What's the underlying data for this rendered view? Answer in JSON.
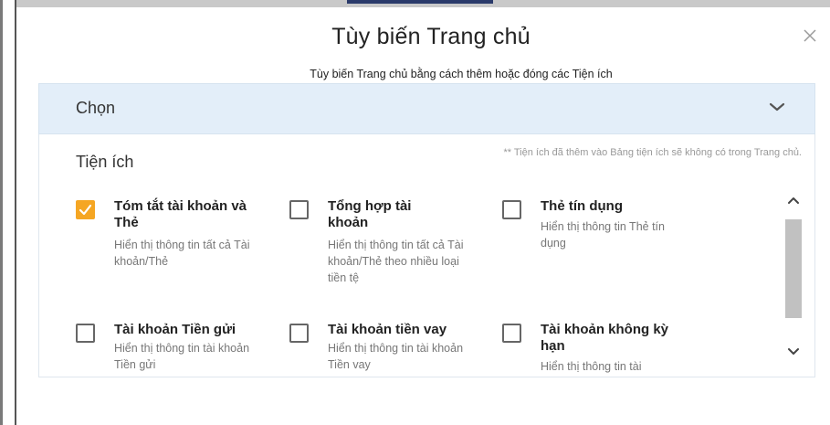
{
  "modal": {
    "title": "Tùy biến Trang chủ",
    "subtitle": "Tùy biến Trang chủ bằng cách thêm hoặc đóng các Tiện ích",
    "close_icon": "close-icon"
  },
  "select": {
    "label": "Chọn",
    "icon": "chevron-down-icon"
  },
  "widgets": {
    "title": "Tiện ích",
    "note": "** Tiện ích đã thêm vào Bảng tiện ích sẽ không có trong Trang chủ.",
    "items": [
      {
        "title": "Tóm tắt tài khoản và Thẻ",
        "desc": "Hiển thị thông tin tất cả Tài khoản/Thẻ",
        "checked": true
      },
      {
        "title": "Tổng hợp tài khoản",
        "desc": "Hiển thị thông tin tất cả Tài khoản/Thẻ theo nhiều loại tiền tệ",
        "checked": false
      },
      {
        "title": "Thẻ tín dụng",
        "desc": "Hiển thị thông tin Thẻ tín dụng",
        "checked": false
      },
      {
        "title": "Tài khoản Tiền gửi",
        "desc": "Hiển thị thông tin tài khoản Tiền gửi",
        "checked": false
      },
      {
        "title": "Tài khoản tiền vay",
        "desc": "Hiển thị thông tin tài khoản Tiền vay",
        "checked": false
      },
      {
        "title": "Tài khoản không kỳ hạn",
        "desc": "Hiển thị thông tin tài",
        "checked": false
      }
    ]
  },
  "colors": {
    "accent": "#f5a623",
    "select_bg": "#e3eef9"
  }
}
